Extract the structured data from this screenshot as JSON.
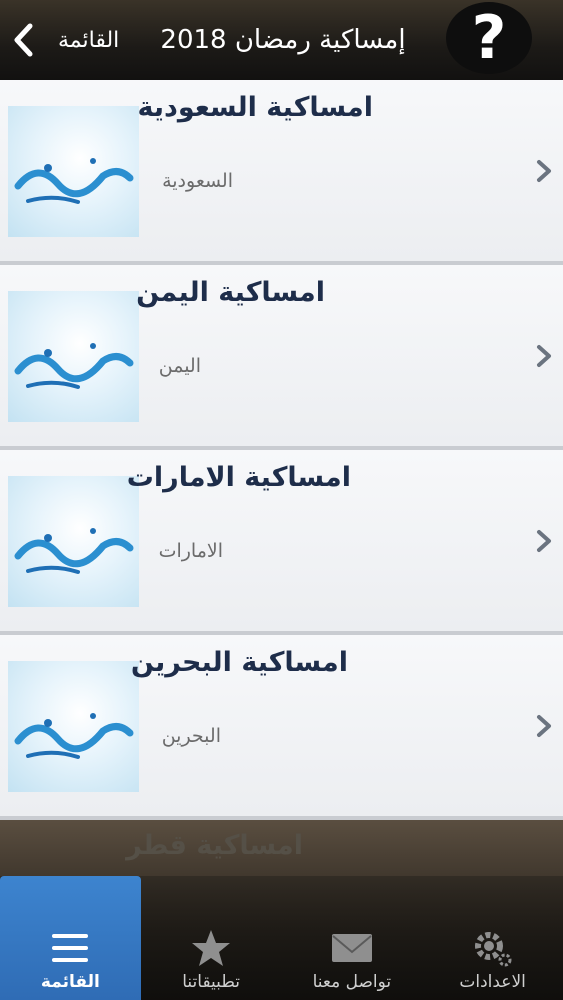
{
  "header": {
    "back_label": "القائمة",
    "title": "إمساكية رمضان 2018",
    "help_label": "?"
  },
  "list": [
    {
      "title": "امساكية  السعودية",
      "subtitle": "السعودية"
    },
    {
      "title": "امساكية اليمن",
      "subtitle": "اليمن"
    },
    {
      "title": "امساكية الامارات",
      "subtitle": "الامارات"
    },
    {
      "title": "امساكية البحرين",
      "subtitle": "البحرين"
    }
  ],
  "peek": {
    "title": "امساكية قطر"
  },
  "tabs": [
    {
      "label": "القائمة",
      "icon": "menu-icon",
      "active": true
    },
    {
      "label": "تطبيقاتنا",
      "icon": "star-icon",
      "active": false
    },
    {
      "label": "تواصل معنا",
      "icon": "envelope-icon",
      "active": false
    },
    {
      "label": "الاعدادات",
      "icon": "gear-icon",
      "active": false
    }
  ],
  "colors": {
    "accent": "#3478c6",
    "title_text": "#1e2d4a"
  }
}
